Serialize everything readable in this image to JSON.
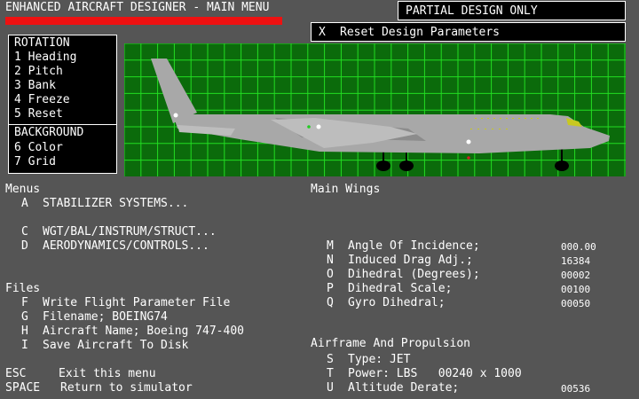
{
  "header": {
    "title": "ENHANCED AIRCRAFT DESIGNER - MAIN MENU",
    "status": "PARTIAL DESIGN ONLY",
    "reset_key": "X",
    "reset_label": "Reset Design Parameters"
  },
  "rotation": {
    "heading": "ROTATION",
    "items": [
      "1 Heading",
      "2 Pitch",
      "3 Bank",
      "4 Freeze",
      "5 Reset"
    ]
  },
  "background": {
    "heading": "BACKGROUND",
    "items": [
      "6 Color",
      "7 Grid"
    ]
  },
  "menus": {
    "heading": "Menus",
    "items": [
      {
        "key": "A",
        "label": "STABILIZER SYSTEMS..."
      },
      {
        "key": "C",
        "label": "WGT/BAL/INSTRUM/STRUCT..."
      },
      {
        "key": "D",
        "label": "AERODYNAMICS/CONTROLS..."
      }
    ]
  },
  "files": {
    "heading": "Files",
    "items": [
      {
        "key": "F",
        "label": "Write Flight Parameter File"
      },
      {
        "key": "G",
        "label": "Filename; BOEING74"
      },
      {
        "key": "H",
        "label": "Aircraft Name; Boeing 747-400"
      },
      {
        "key": "I",
        "label": "Save Aircraft To Disk"
      }
    ]
  },
  "system": {
    "items": [
      {
        "key": "ESC",
        "label": "Exit this menu"
      },
      {
        "key": "SPACE",
        "label": "Return to simulator"
      }
    ]
  },
  "main_wings": {
    "heading": "Main Wings",
    "items": [
      {
        "key": "M",
        "label": "Angle Of Incidence;",
        "value": "000.00"
      },
      {
        "key": "N",
        "label": "Induced Drag Adj.;",
        "value": "16384"
      },
      {
        "key": "O",
        "label": "Dihedral (Degrees);",
        "value": "00002"
      },
      {
        "key": "P",
        "label": "Dihedral Scale;",
        "value": "00100"
      },
      {
        "key": "Q",
        "label": "Gyro Dihedral;",
        "value": "00050"
      }
    ]
  },
  "airframe": {
    "heading": "Airframe And Propulsion",
    "items": [
      {
        "key": "S",
        "label": "Type: JET",
        "value": ""
      },
      {
        "key": "T",
        "label": "Power: LBS   00240 x 1000",
        "value": ""
      },
      {
        "key": "U",
        "label": "Altitude Derate;",
        "value": "00536"
      }
    ]
  },
  "colors": {
    "background": "#555555",
    "viewport": "#0b6b0b",
    "grid": "#22dd22",
    "accent": "#ee1111",
    "fuselage": "#a8a8a8"
  }
}
